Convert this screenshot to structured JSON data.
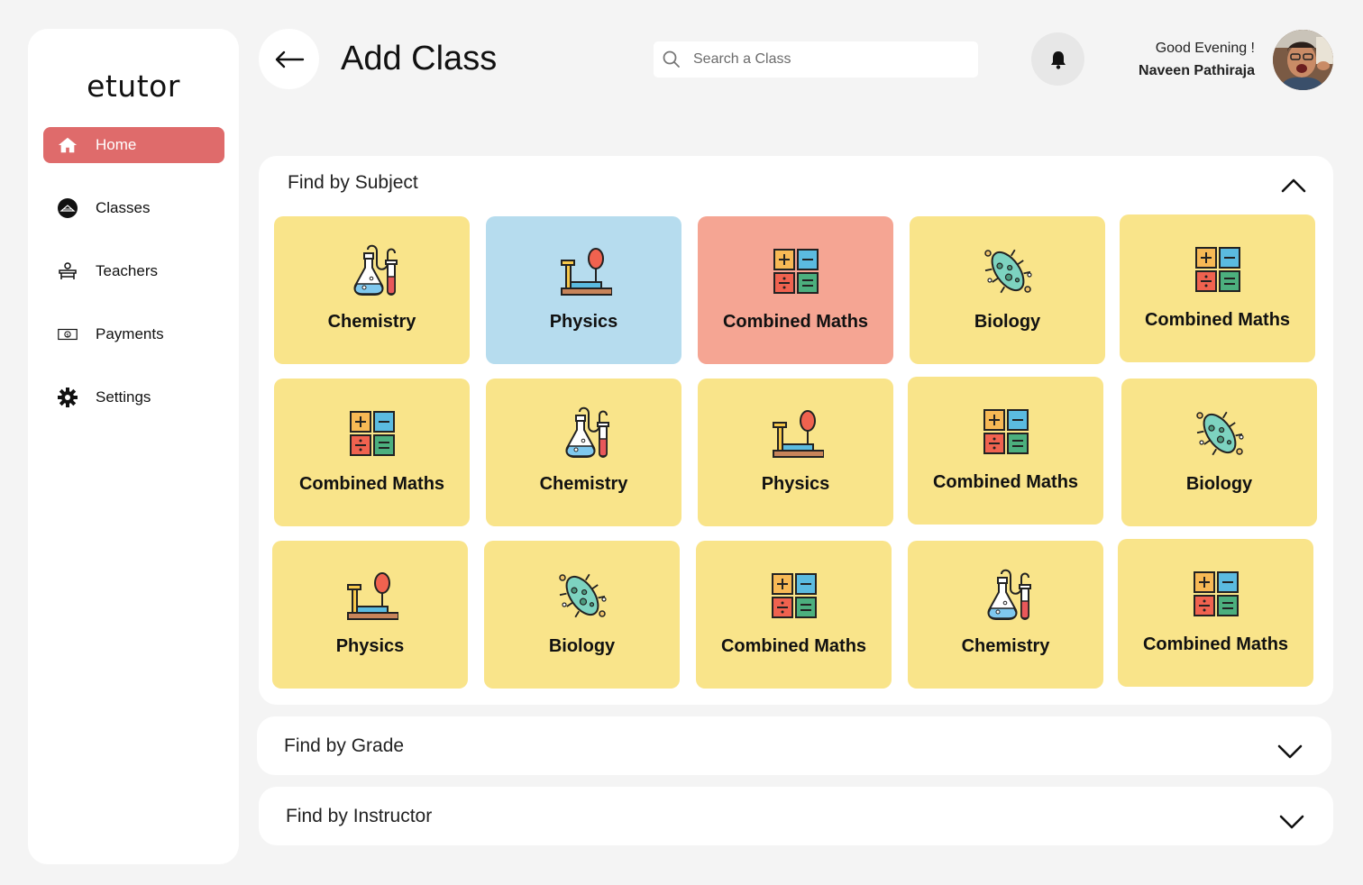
{
  "app": {
    "logo": "etutor"
  },
  "sidebar": {
    "items": [
      {
        "label": "Home",
        "icon": "home-icon",
        "active": true
      },
      {
        "label": "Classes",
        "icon": "classes-icon",
        "active": false
      },
      {
        "label": "Teachers",
        "icon": "teachers-icon",
        "active": false
      },
      {
        "label": "Payments",
        "icon": "payments-icon",
        "active": false
      },
      {
        "label": "Settings",
        "icon": "gear-icon",
        "active": false
      }
    ]
  },
  "header": {
    "title": "Add Class",
    "search_placeholder": "Search a Class",
    "greeting": "Good Evening !",
    "user_name": "Naveen Pathiraja"
  },
  "sections": {
    "subject": {
      "title": "Find by Subject",
      "expanded": true
    },
    "grade": {
      "title": "Find by Grade",
      "expanded": false
    },
    "instructor": {
      "title": "Find by Instructor",
      "expanded": false
    }
  },
  "subjects": [
    {
      "label": "Chemistry",
      "icon": "chemistry-icon",
      "color": "#f9e48a"
    },
    {
      "label": "Physics",
      "icon": "physics-icon",
      "color": "#b6dcee"
    },
    {
      "label": "Combined Maths",
      "icon": "maths-icon",
      "color": "#f5a593"
    },
    {
      "label": "Biology",
      "icon": "biology-icon",
      "color": "#f9e48a"
    },
    {
      "label": "Combined Maths",
      "icon": "maths-icon",
      "color": "#f9e48a"
    },
    {
      "label": "Combined Maths",
      "icon": "maths-icon",
      "color": "#f9e48a"
    },
    {
      "label": "Chemistry",
      "icon": "chemistry-icon",
      "color": "#f9e48a"
    },
    {
      "label": "Physics",
      "icon": "physics-icon",
      "color": "#f9e48a"
    },
    {
      "label": "Combined Maths",
      "icon": "maths-icon",
      "color": "#f9e48a"
    },
    {
      "label": "Biology",
      "icon": "biology-icon",
      "color": "#f9e48a"
    },
    {
      "label": "Physics",
      "icon": "physics-icon",
      "color": "#f9e48a"
    },
    {
      "label": "Biology",
      "icon": "biology-icon",
      "color": "#f9e48a"
    },
    {
      "label": "Combined Maths",
      "icon": "maths-icon",
      "color": "#f9e48a"
    },
    {
      "label": "Chemistry",
      "icon": "chemistry-icon",
      "color": "#f9e48a"
    },
    {
      "label": "Combined Maths",
      "icon": "maths-icon",
      "color": "#f9e48a"
    }
  ]
}
